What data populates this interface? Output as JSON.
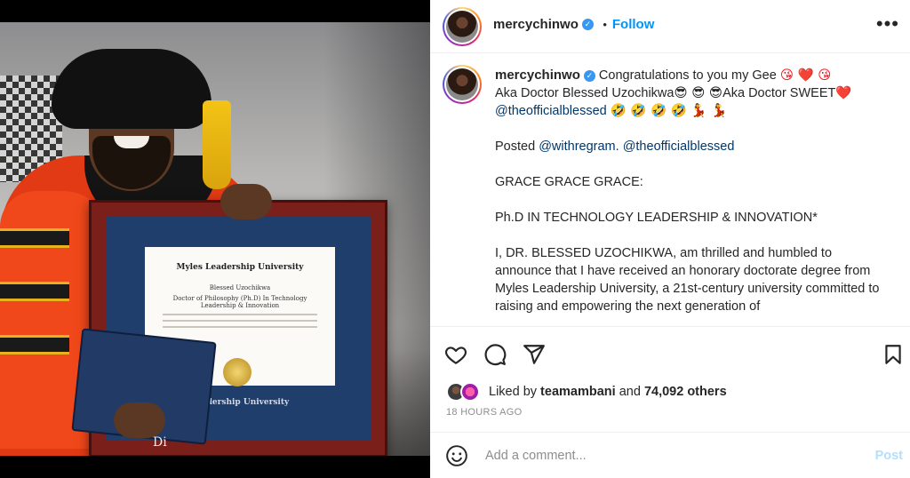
{
  "header": {
    "username": "mercychinwo",
    "separator": "•",
    "follow_label": "Follow",
    "more_label": "•••"
  },
  "caption": {
    "username": "mercychinwo",
    "line1_text": "Congratulations to you my Gee",
    "line1_emojis": "😘 ❤️ 😘",
    "line2_text_a": "Aka Doctor Blessed Uzochikwa",
    "line2_emojis": "😎 😎 😎",
    "line2_text_b": "Aka Doctor SWEET",
    "line2_heart": "❤️",
    "line3_mention": "@theofficialblessed",
    "line3_emojis": "🤣 🤣 🤣 🤣 💃 💃",
    "posted_label": "Posted",
    "posted_mention1": "@withregram.",
    "posted_mention2": "@theofficialblessed",
    "grace": "GRACE GRACE GRACE:",
    "degree": "Ph.D IN TECHNOLOGY LEADERSHIP & INNOVATION*",
    "body": "I, DR. BLESSED UZOCHIKWA, am thrilled and humbled to announce that I have received an honorary doctorate degree from Myles Leadership University, a 21st-century university committed to raising and empowering the next generation of"
  },
  "photo": {
    "certificate_title": "Myles Leadership University",
    "certificate_name": "Blessed Uzochikwa",
    "certificate_degree": "Doctor of Philosophy (Ph.D) In Technology Leadership & Innovation",
    "frame_footer": "Leadership University",
    "signature": "Di"
  },
  "engagement": {
    "liked_by_label": "Liked by",
    "liked_by_user": "teamambani",
    "and_label": "and",
    "others_count": "74,092 others",
    "timestamp": "18 HOURS AGO"
  },
  "comment": {
    "placeholder": "Add a comment...",
    "post_label": "Post"
  },
  "colors": {
    "link": "#00376b",
    "accent": "#0095f6",
    "verified": "#3897f0",
    "heart": "#ed1c24"
  },
  "icons": [
    "verified-badge-icon",
    "more-options-icon",
    "heart-icon",
    "comment-icon",
    "share-icon",
    "bookmark-icon",
    "emoji-icon"
  ]
}
